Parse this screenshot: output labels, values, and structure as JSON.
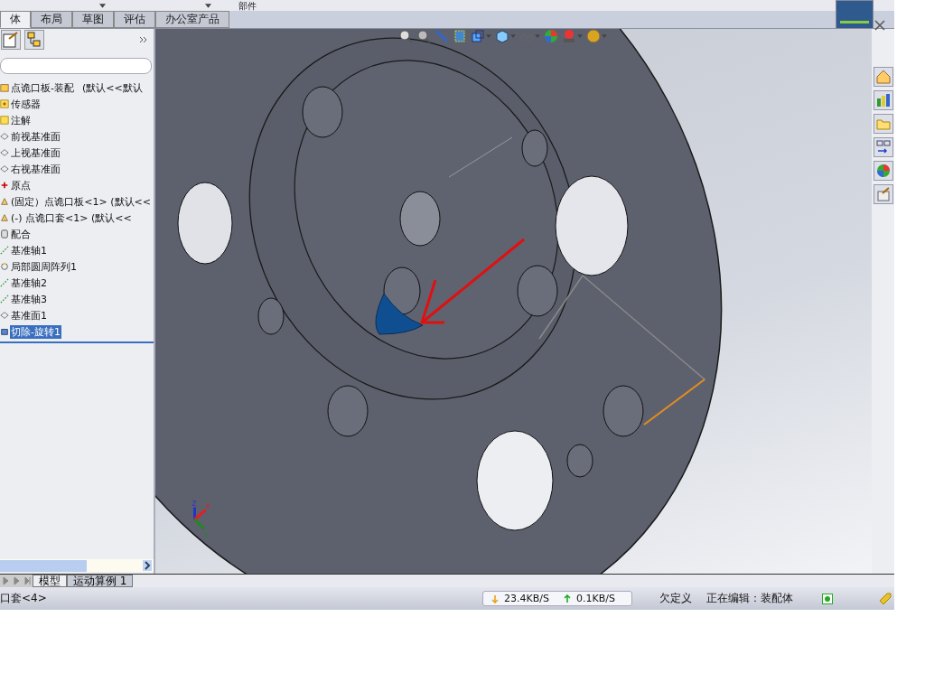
{
  "top_strip": {
    "label": "部件"
  },
  "command_tabs": [
    {
      "label": "体",
      "selected": true
    },
    {
      "label": "布局",
      "selected": false
    },
    {
      "label": "草图",
      "selected": false
    },
    {
      "label": "评估",
      "selected": false
    },
    {
      "label": "办公室产品",
      "selected": false
    }
  ],
  "feature_tree": {
    "root": {
      "name": "点诡口板-装配",
      "config": "(默认<<默认",
      "children": [
        {
          "label": "传感器",
          "kind": "sensor",
          "selected": false
        },
        {
          "label": "注解",
          "kind": "annotation",
          "selected": false
        },
        {
          "label": "前视基准面",
          "kind": "plane",
          "selected": false
        },
        {
          "label": "上视基准面",
          "kind": "plane",
          "selected": false
        },
        {
          "label": "右视基准面",
          "kind": "plane",
          "selected": false
        },
        {
          "label": "原点",
          "kind": "origin",
          "selected": false
        },
        {
          "label": "(固定）点诡口板<1>  (默认<<",
          "kind": "part",
          "selected": false
        },
        {
          "label": "(-) 点诡口套<1>  (默认<<",
          "kind": "part",
          "selected": false
        },
        {
          "label": "配合",
          "kind": "mates",
          "selected": false
        },
        {
          "label": "基准轴1",
          "kind": "axis",
          "selected": false
        },
        {
          "label": "局部圆周阵列1",
          "kind": "pattern",
          "selected": false
        },
        {
          "label": "基准轴2",
          "kind": "axis",
          "selected": false
        },
        {
          "label": "基准轴3",
          "kind": "axis",
          "selected": false
        },
        {
          "label": "基准面1",
          "kind": "plane",
          "selected": false
        },
        {
          "label": "切除-旋转1",
          "kind": "cut",
          "selected": true
        }
      ]
    }
  },
  "triad": {
    "labels": [
      "Z",
      "X",
      "Y"
    ]
  },
  "model_tabs": [
    {
      "label": "模型",
      "selected": true
    },
    {
      "label": "运动算例 1",
      "selected": false
    }
  ],
  "status_bar": {
    "left": "口套<4>",
    "download": "23.4KB/S",
    "upload": "0.1KB/S",
    "state": "欠定义",
    "editing": "正在编辑：装配体"
  }
}
